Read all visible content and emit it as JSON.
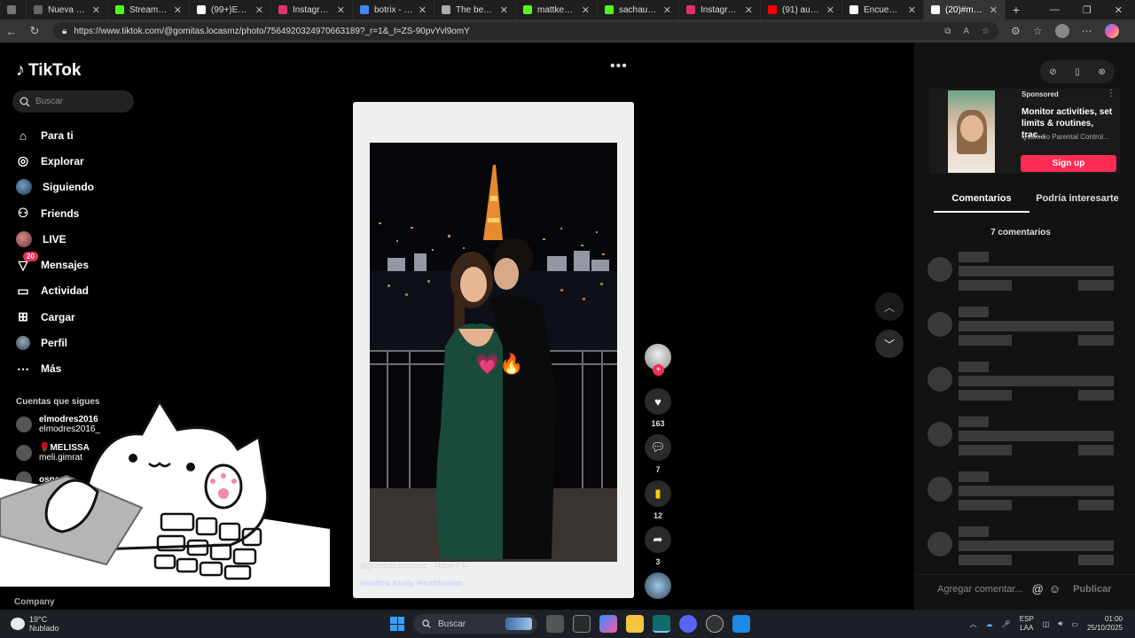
{
  "browser": {
    "tabs": [
      {
        "label": "",
        "color": "#777"
      },
      {
        "label": "Nueva pestaña",
        "color": "#666"
      },
      {
        "label": "Stream - Kick",
        "color": "#53fc18"
      },
      {
        "label": "(99+)Encuentr...",
        "color": "#fff"
      },
      {
        "label": "Instagram",
        "color": "#e1306c"
      },
      {
        "label": "botrix - Búsqu...",
        "color": "#4285f4"
      },
      {
        "label": "The best Chat...",
        "color": "#aaa"
      },
      {
        "label": "mattkeelan Str...",
        "color": "#53fc18"
      },
      {
        "label": "sachauzumaki...",
        "color": "#53fc18"
      },
      {
        "label": "Instagram",
        "color": "#e1306c"
      },
      {
        "label": "(91) audio FU...",
        "color": "#ff0000"
      },
      {
        "label": "Encuentra 'CO...",
        "color": "#fff"
      },
      {
        "label": "(20)#mattzu #...",
        "color": "#fff"
      }
    ],
    "url": "https://www.tiktok.com/@gomitas.locasmz/photo/7564920324970663189?_r=1&_t=ZS-90pvYvl9omY"
  },
  "nav": {
    "logo": "TikTok",
    "search_placeholder": "Buscar",
    "items": [
      {
        "label": "Para ti",
        "icon": "home-icon"
      },
      {
        "label": "Explorar",
        "icon": "compass-icon"
      },
      {
        "label": "Siguiendo",
        "icon": "following-avatar"
      },
      {
        "label": "Friends",
        "icon": "friends-icon"
      },
      {
        "label": "LIVE",
        "icon": "live-avatar"
      },
      {
        "label": "Mensajes",
        "icon": "messages-icon",
        "badge": "20"
      },
      {
        "label": "Actividad",
        "icon": "activity-icon"
      },
      {
        "label": "Cargar",
        "icon": "upload-icon"
      },
      {
        "label": "Perfil",
        "icon": "profile-icon"
      },
      {
        "label": "Más",
        "icon": "more-icon"
      }
    ],
    "following_title": "Cuentas que sigues",
    "following": [
      {
        "name": "elmodres2016",
        "handle": "elmodres2016_"
      },
      {
        "name": "🌹MELISSA",
        "handle": "meli.gimrat"
      },
      {
        "name": "osne Su",
        "handle": ""
      }
    ],
    "footer": "Company"
  },
  "post": {
    "caption_user": "@gomitas.locasmz · Hace 7 h",
    "hashtags": "#mattzu  #zully  #mattkeelan",
    "emoji": "💗🔥",
    "likes": "163",
    "comments": "7",
    "saves": "12",
    "shares": "3"
  },
  "ad": {
    "sponsored": "Sponsored",
    "title": "Monitor activities, set limits & routines, trac...",
    "brand": "Qustodio Parental Control...",
    "cta": "Sign up"
  },
  "comments_panel": {
    "tab_comments": "Comentarios",
    "tab_interest": "Podría interesarte",
    "count": "7 comentarios",
    "input_placeholder": "Agregar comentar...",
    "publish": "Publicar"
  },
  "taskbar": {
    "temp": "19°C",
    "weather": "Nublado",
    "search": "Buscar",
    "lang1": "ESP",
    "lang2": "LAA",
    "time": "01:00",
    "date": "25/10/2025"
  },
  "colors": {
    "accent": "#fe2c55",
    "bg": "#000000",
    "panel": "#121212"
  }
}
